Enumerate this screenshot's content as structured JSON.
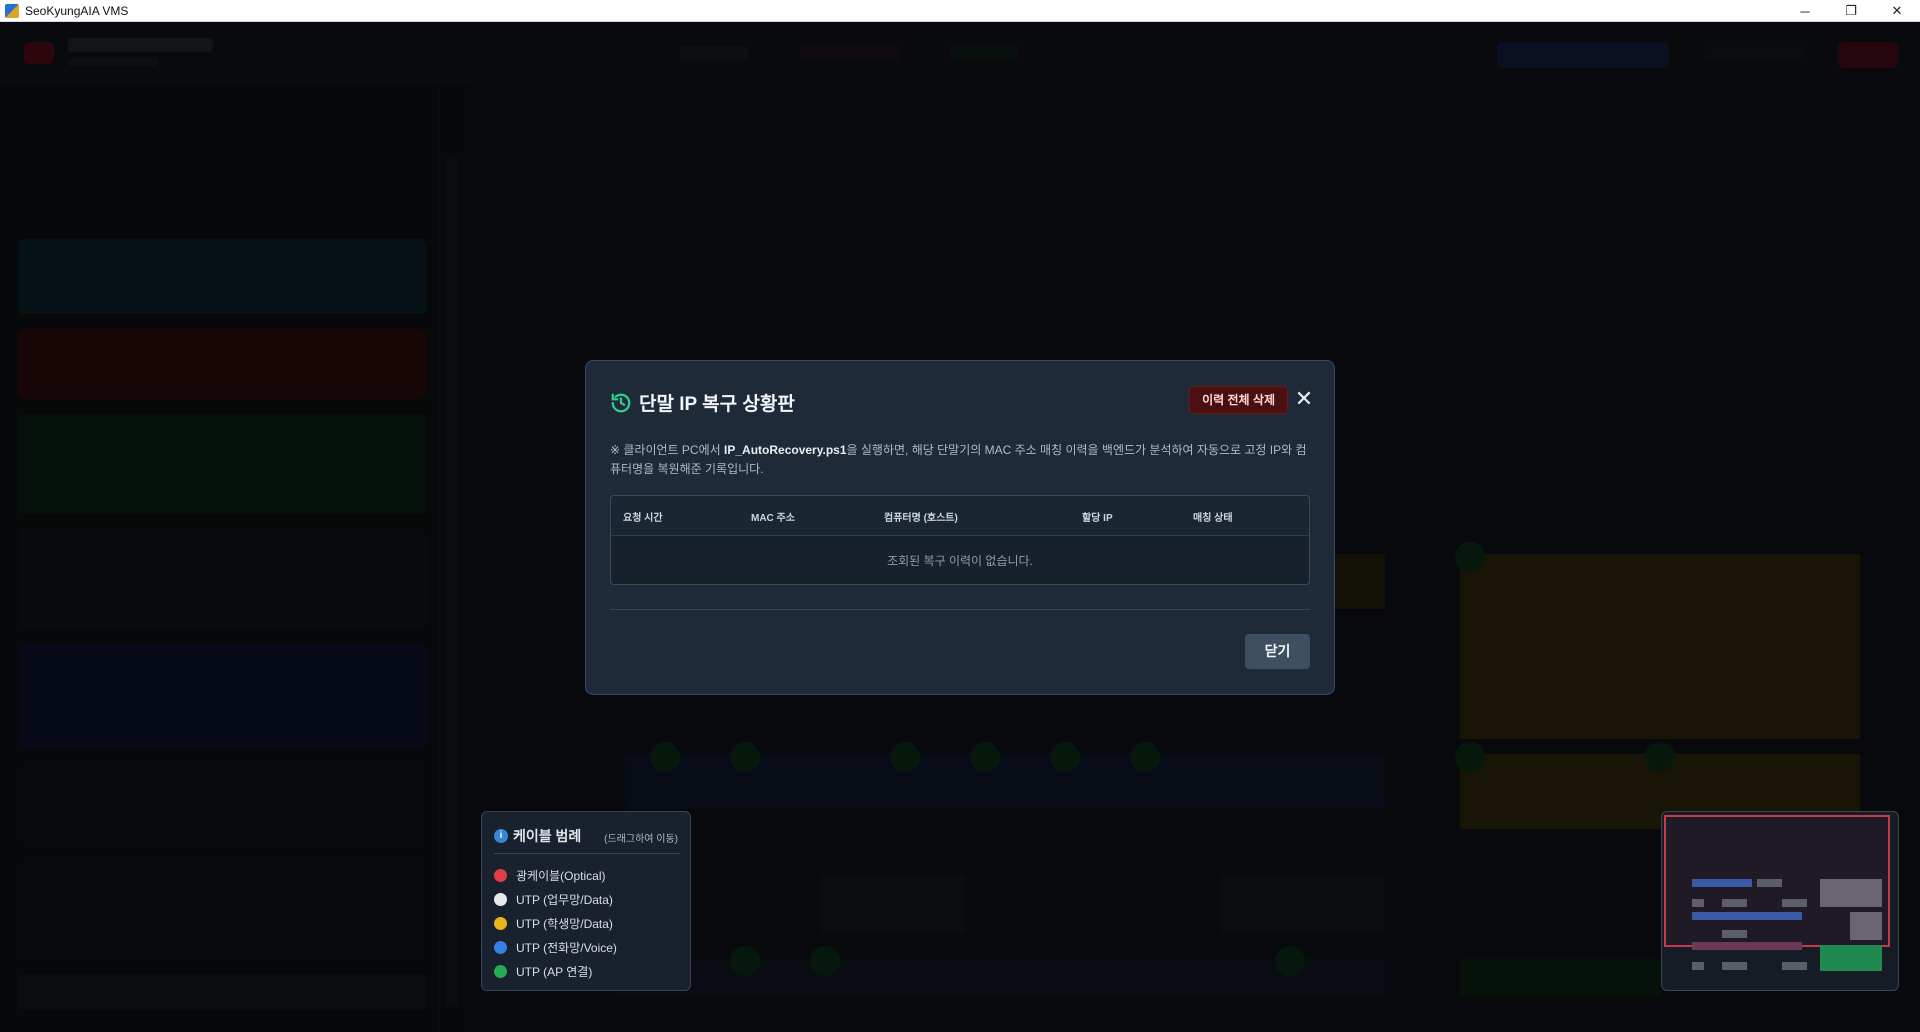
{
  "window": {
    "title": "SeoKyungAIA VMS",
    "controls": {
      "minimize": "─",
      "maximize": "❐",
      "close": "✕"
    }
  },
  "modal": {
    "title": "단말 IP 복구 상황판",
    "clear_all_label": "이력 전체 삭제",
    "close_x": "✕",
    "desc_prefix": "※ 클라이언트 PC에서 ",
    "desc_script": "IP_AutoRecovery.ps1",
    "desc_suffix": "을 실행하면, 해당 단말기의 MAC 주소 매칭 이력을 백엔드가 분석하여 자동으로 고정 IP와 컴퓨터명을 복원해준 기록입니다.",
    "columns": [
      "요청 시간",
      "MAC 주소",
      "컴퓨터명 (호스트)",
      "할당 IP",
      "매칭 상태"
    ],
    "empty_text": "조회된 복구 이력이 없습니다.",
    "close_label": "닫기"
  },
  "legend": {
    "title": "케이블 범례",
    "hint": "(드래그하여 이동)",
    "info_icon": "i",
    "items": [
      {
        "label": "광케이블(Optical)",
        "color": "#e8424a"
      },
      {
        "label": "UTP (업무망/Data)",
        "color": "#f5f5f5"
      },
      {
        "label": "UTP (학생망/Data)",
        "color": "#f2bf1a"
      },
      {
        "label": "UTP (전화망/Voice)",
        "color": "#3a86f0"
      },
      {
        "label": "UTP (AP 연결)",
        "color": "#27b35a"
      }
    ]
  },
  "colors": {
    "accent_green": "#2fd08a",
    "danger": "#4a0f10",
    "minimap_frame": "#c33a4a"
  }
}
